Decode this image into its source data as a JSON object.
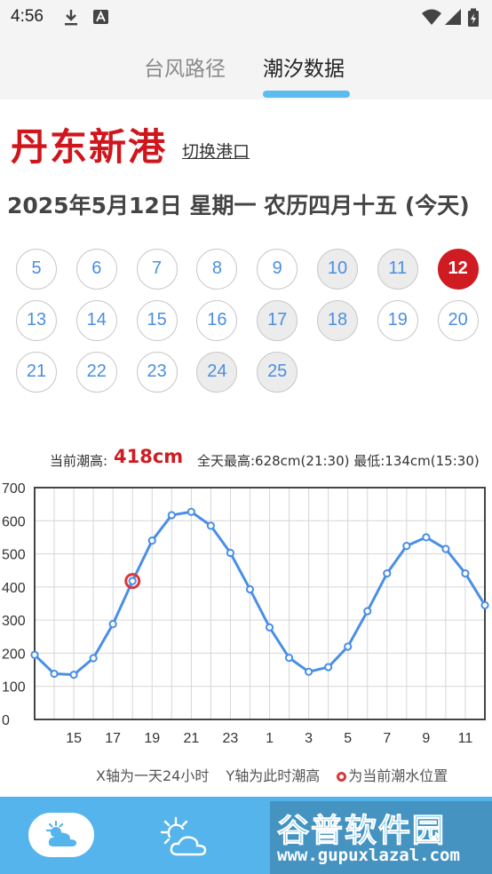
{
  "status_bar": {
    "time": "4:56"
  },
  "tabs": [
    {
      "label": "台风路径",
      "active": false
    },
    {
      "label": "潮汐数据",
      "active": true
    }
  ],
  "port": {
    "name": "丹东新港",
    "switch_label": "切换港口"
  },
  "date_line": "2025年5月12日 星期一 农历四月十五 (今天)",
  "days": [
    {
      "label": "5",
      "state": "normal"
    },
    {
      "label": "6",
      "state": "normal"
    },
    {
      "label": "7",
      "state": "normal"
    },
    {
      "label": "8",
      "state": "normal"
    },
    {
      "label": "9",
      "state": "normal"
    },
    {
      "label": "10",
      "state": "past"
    },
    {
      "label": "11",
      "state": "past"
    },
    {
      "label": "12",
      "state": "today"
    },
    {
      "label": "13",
      "state": "normal"
    },
    {
      "label": "14",
      "state": "normal"
    },
    {
      "label": "15",
      "state": "normal"
    },
    {
      "label": "16",
      "state": "normal"
    },
    {
      "label": "17",
      "state": "past"
    },
    {
      "label": "18",
      "state": "past"
    },
    {
      "label": "19",
      "state": "normal"
    },
    {
      "label": "20",
      "state": "normal"
    },
    {
      "label": "21",
      "state": "normal"
    },
    {
      "label": "22",
      "state": "normal"
    },
    {
      "label": "23",
      "state": "normal"
    },
    {
      "label": "24",
      "state": "past"
    },
    {
      "label": "25",
      "state": "past"
    }
  ],
  "tide_summary": {
    "current_label": "当前潮高:",
    "current_value": "418cm",
    "max_min": "全天最高:628cm(21:30) 最低:134cm(15:30)"
  },
  "chart_data": {
    "type": "line",
    "x": [
      13,
      14,
      15,
      16,
      17,
      18,
      19,
      20,
      21,
      22,
      23,
      24,
      25,
      26,
      27,
      28,
      29,
      30,
      31,
      32,
      33,
      34,
      35,
      36
    ],
    "x_tick_labels": [
      "15",
      "17",
      "19",
      "21",
      "23",
      "1",
      "3",
      "5",
      "7",
      "9",
      "11"
    ],
    "x_tick_positions": [
      15,
      17,
      19,
      21,
      23,
      25,
      27,
      29,
      31,
      33,
      35
    ],
    "series": [
      {
        "values": [
          195,
          138,
          135,
          185,
          288,
          418,
          540,
          617,
          627,
          585,
          503,
          393,
          278,
          186,
          144,
          158,
          220,
          327,
          441,
          524,
          550,
          515,
          441,
          345
        ]
      }
    ],
    "current_point": {
      "x": 18,
      "y": 418
    },
    "ylim": [
      0,
      700
    ],
    "y_ticks": [
      0,
      100,
      200,
      300,
      400,
      500,
      600,
      700
    ],
    "xlim": [
      13,
      36
    ],
    "grid": true,
    "line_color": "#4a8fe6",
    "marker_color": "#d9383c"
  },
  "legend": {
    "x_axis_note": "X轴为一天24小时",
    "y_axis_note": "Y轴为此时潮高",
    "marker_note": "为当前潮水位置"
  },
  "watermark": {
    "title": "谷普软件园",
    "url": "www.gupuxlazal.com"
  },
  "colors": {
    "accent": "#55b4ec",
    "today": "#cf1b22",
    "tab_indicator": "#5bbcf0"
  }
}
